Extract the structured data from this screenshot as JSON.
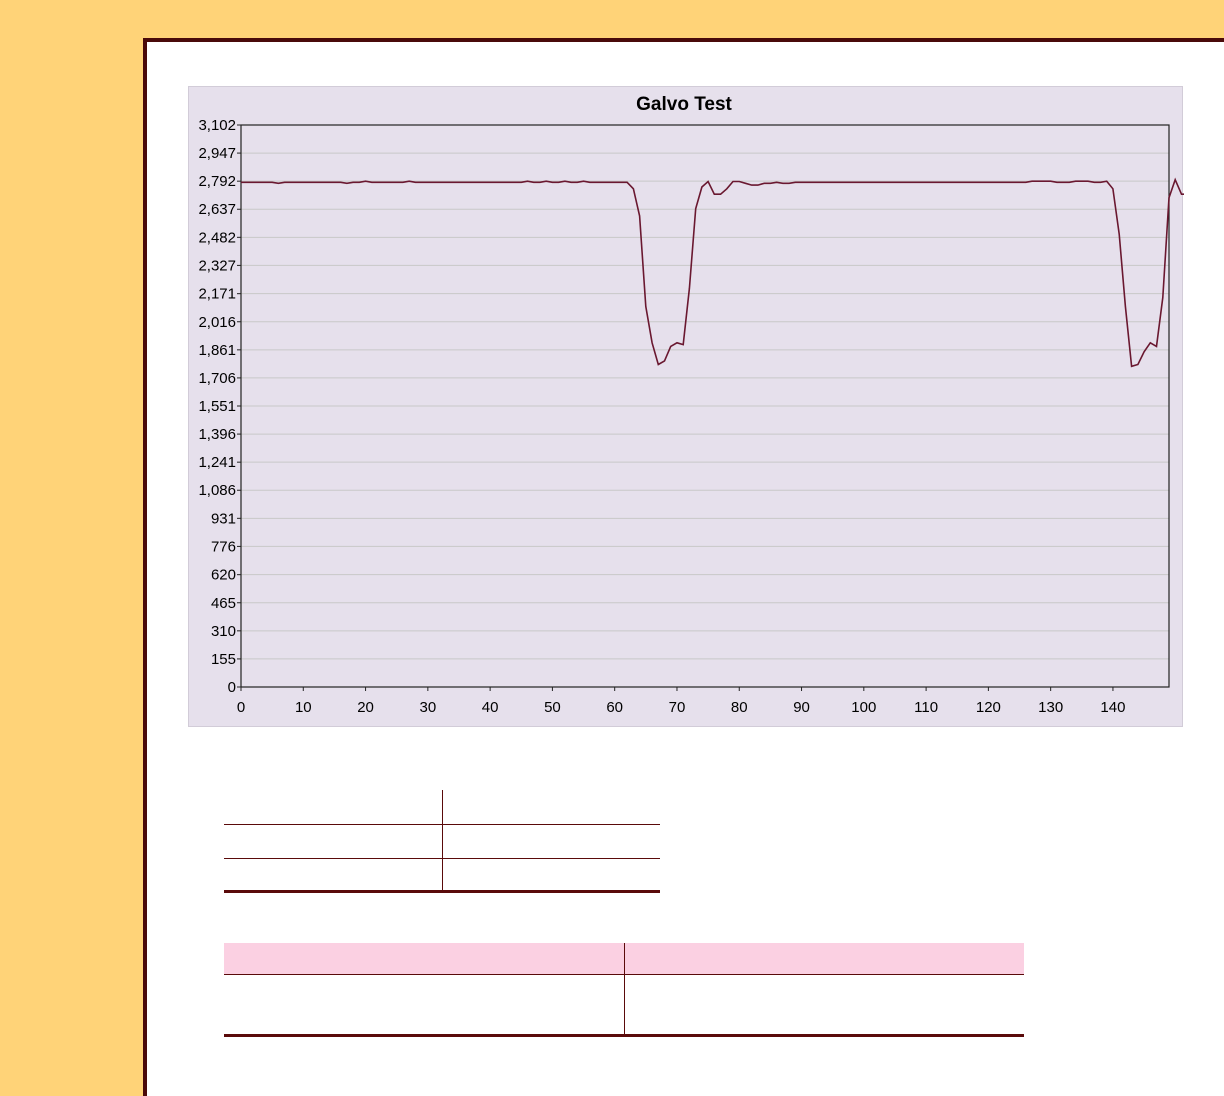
{
  "chart_data": {
    "type": "line",
    "title": "Galvo Test",
    "xlabel": "",
    "ylabel": "",
    "xlim": [
      0,
      149
    ],
    "ylim": [
      0,
      3102
    ],
    "x_ticks": [
      "0",
      "10",
      "20",
      "30",
      "40",
      "50",
      "60",
      "70",
      "80",
      "90",
      "100",
      "110",
      "120",
      "130",
      "140"
    ],
    "y_ticks": [
      "0",
      "155",
      "310",
      "465",
      "620",
      "776",
      "931",
      "1,086",
      "1,241",
      "1,396",
      "1,551",
      "1,706",
      "1,861",
      "2,016",
      "2,171",
      "2,327",
      "2,482",
      "2,637",
      "2,792",
      "2,947",
      "3,102"
    ],
    "grid": true,
    "line_color": "#6a1830",
    "series": [
      {
        "name": "",
        "values": [
          2786,
          2786,
          2786,
          2786,
          2786,
          2786,
          2780,
          2786,
          2786,
          2786,
          2786,
          2786,
          2786,
          2786,
          2786,
          2786,
          2786,
          2780,
          2786,
          2786,
          2792,
          2786,
          2786,
          2786,
          2786,
          2786,
          2786,
          2792,
          2786,
          2786,
          2786,
          2786,
          2786,
          2786,
          2786,
          2786,
          2786,
          2786,
          2786,
          2786,
          2786,
          2786,
          2786,
          2786,
          2786,
          2786,
          2792,
          2786,
          2786,
          2792,
          2786,
          2786,
          2792,
          2786,
          2786,
          2792,
          2786,
          2786,
          2786,
          2786,
          2786,
          2786,
          2786,
          2750,
          2600,
          2100,
          1900,
          1780,
          1800,
          1880,
          1900,
          1890,
          2200,
          2640,
          2760,
          2790,
          2720,
          2720,
          2750,
          2790,
          2790,
          2780,
          2770,
          2770,
          2780,
          2780,
          2786,
          2780,
          2780,
          2786,
          2786,
          2786,
          2786,
          2786,
          2786,
          2786,
          2786,
          2786,
          2786,
          2786,
          2786,
          2786,
          2786,
          2786,
          2786,
          2786,
          2786,
          2786,
          2786,
          2786,
          2786,
          2786,
          2786,
          2786,
          2786,
          2786,
          2786,
          2786,
          2786,
          2786,
          2786,
          2786,
          2786,
          2786,
          2786,
          2786,
          2786,
          2792,
          2792,
          2792,
          2792,
          2786,
          2786,
          2786,
          2792,
          2792,
          2792,
          2786,
          2786,
          2792,
          2750,
          2500,
          2100,
          1770,
          1780,
          1850,
          1900,
          1880,
          2150,
          2700,
          2800,
          2720,
          2720,
          2790
        ]
      }
    ]
  },
  "colors": {
    "background": "#ffd378",
    "frame_border": "#4a0a0a",
    "chart_panel": "#e6e0ec",
    "table_rule": "#5a0a0a",
    "table_header": "#fbd0e2"
  }
}
